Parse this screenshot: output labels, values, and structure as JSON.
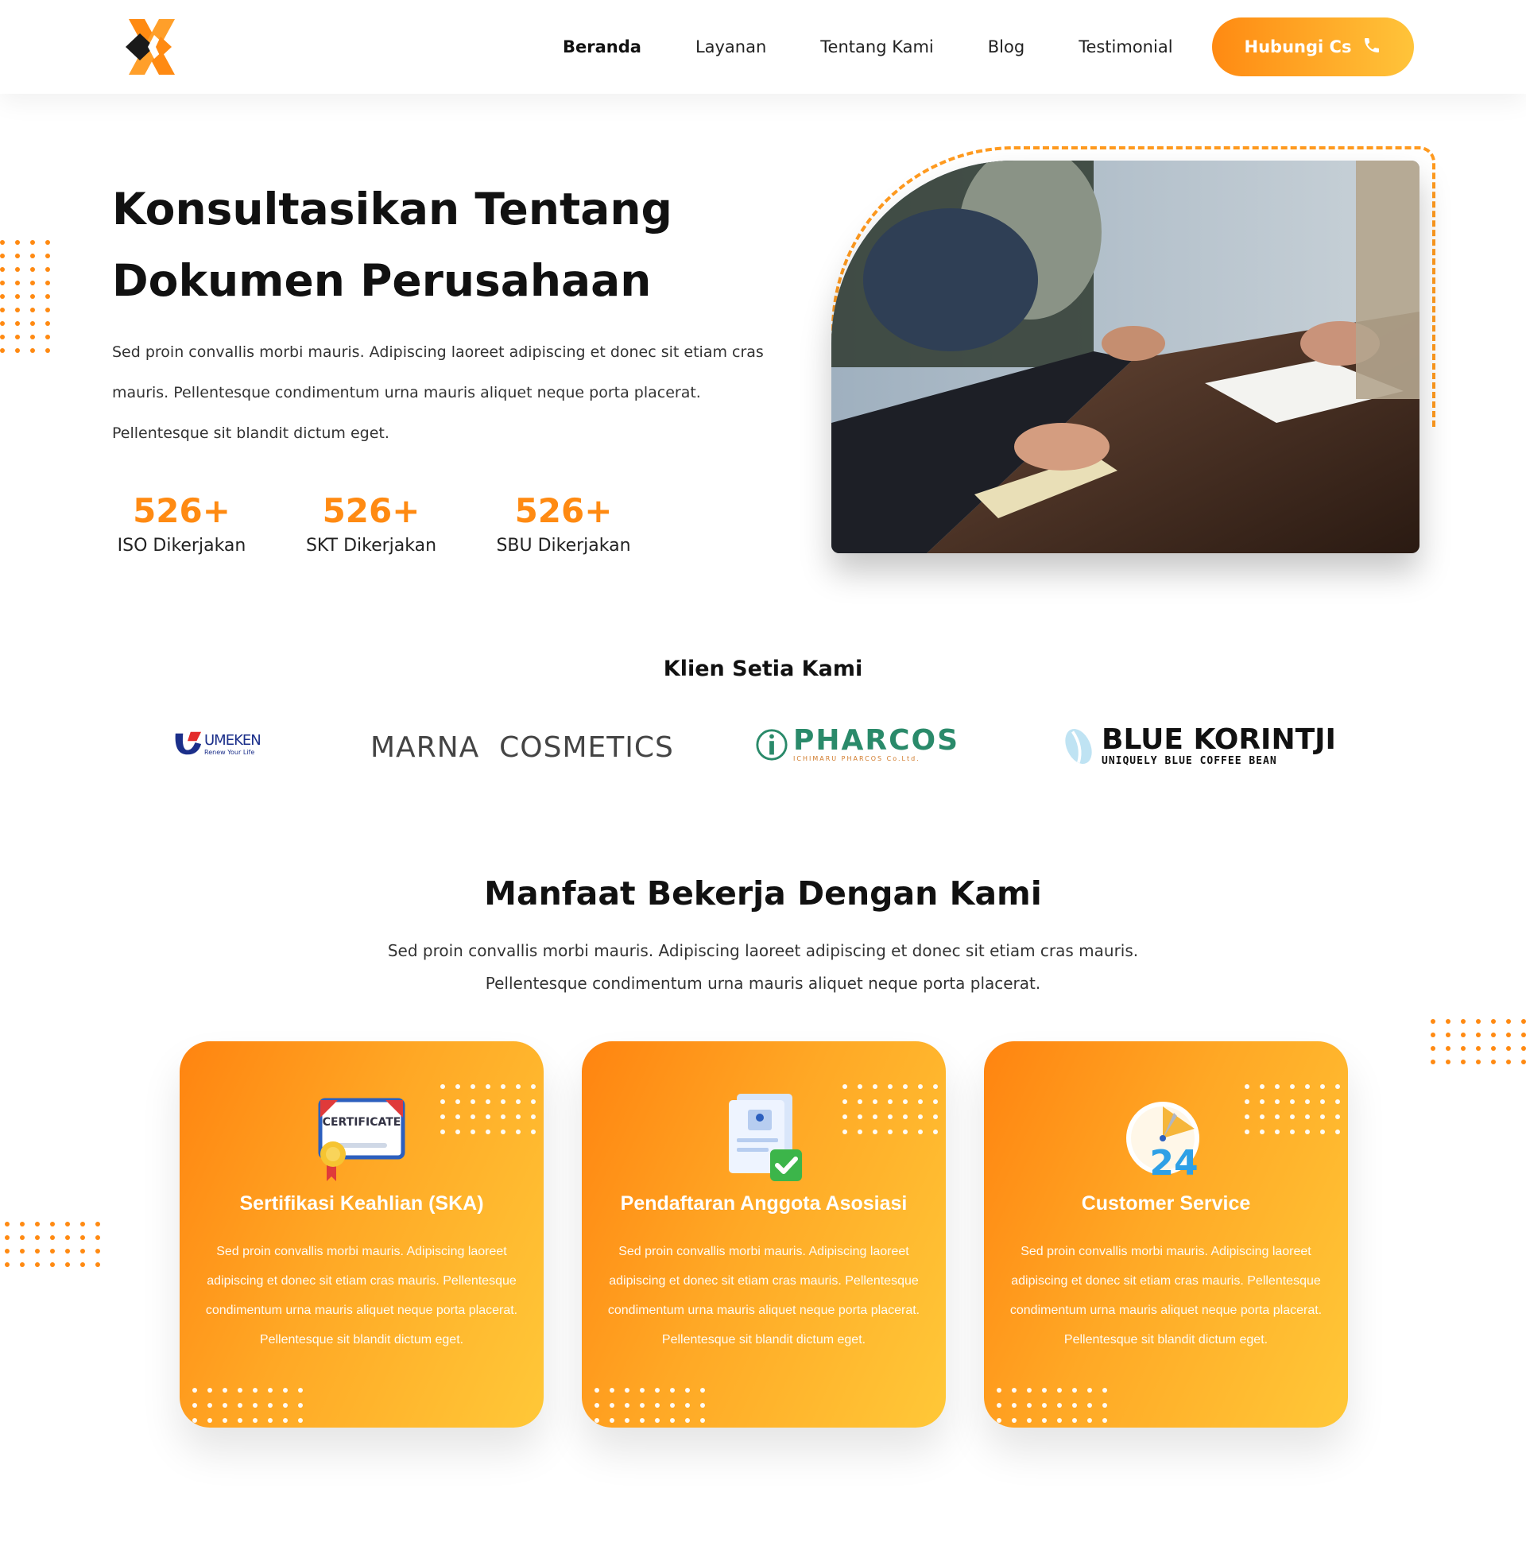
{
  "nav": {
    "items": [
      {
        "label": "Beranda",
        "active": true
      },
      {
        "label": "Layanan",
        "active": false
      },
      {
        "label": "Tentang Kami",
        "active": false
      },
      {
        "label": "Blog",
        "active": false
      },
      {
        "label": "Testimonial",
        "active": false
      }
    ],
    "cta_label": "Hubungi Cs",
    "cta_icon": "phone-icon"
  },
  "hero": {
    "title_line1": "Konsultasikan Tentang",
    "title_line2": "Dokumen Perusahaan",
    "description": "Sed proin convallis morbi mauris. Adipiscing laoreet adipiscing et donec sit etiam cras mauris. Pellentesque condimentum urna mauris aliquet neque porta placerat. Pellentesque sit blandit dictum eget.",
    "stats": [
      {
        "value": "526+",
        "label": "ISO Dikerjakan"
      },
      {
        "value": "526+",
        "label": "SKT Dikerjakan"
      },
      {
        "value": "526+",
        "label": "SBU Dikerjakan"
      }
    ]
  },
  "clients": {
    "heading": "Klien Setia Kami",
    "logos": [
      {
        "name": "UMEKEN",
        "tagline": "Renew Your Life"
      },
      {
        "name": "MARNA  COSMETICS"
      },
      {
        "name": "PHARCOS",
        "tagline": "ICHIMARU PHARCOS Co.Ltd."
      },
      {
        "name": "BLUE KORINTJI",
        "tagline": "UNIQUELY BLUE COFFEE BEAN"
      }
    ]
  },
  "benefits": {
    "heading": "Manfaat Bekerja Dengan Kami",
    "description": "Sed proin convallis morbi mauris. Adipiscing laoreet adipiscing et donec sit etiam cras mauris. Pellentesque condimentum urna mauris aliquet neque porta placerat.",
    "cards": [
      {
        "title": "Sertifikasi Keahlian (SKA)",
        "icon": "certificate-icon",
        "icon_text": "CERTIFICATE",
        "text": "Sed proin convallis morbi mauris. Adipiscing laoreet adipiscing et donec sit etiam cras mauris. Pellentesque condimentum urna mauris aliquet neque porta placerat. Pellentesque sit blandit dictum eget."
      },
      {
        "title": "Pendaftaran Anggota Asosiasi",
        "icon": "document-check-icon",
        "text": "Sed proin convallis morbi mauris. Adipiscing laoreet adipiscing et donec sit etiam cras mauris. Pellentesque condimentum urna mauris aliquet neque porta placerat. Pellentesque sit blandit dictum eget."
      },
      {
        "title": "Customer Service",
        "icon": "clock-24-icon",
        "icon_text": "24",
        "text": "Sed proin convallis morbi mauris. Adipiscing laoreet adipiscing et donec sit etiam cras mauris. Pellentesque condimentum urna mauris aliquet neque porta placerat. Pellentesque sit blandit dictum eget."
      }
    ]
  },
  "colors": {
    "accent": "#ff8a12",
    "accent_light": "#ffc43a",
    "text_dark": "#111111"
  }
}
